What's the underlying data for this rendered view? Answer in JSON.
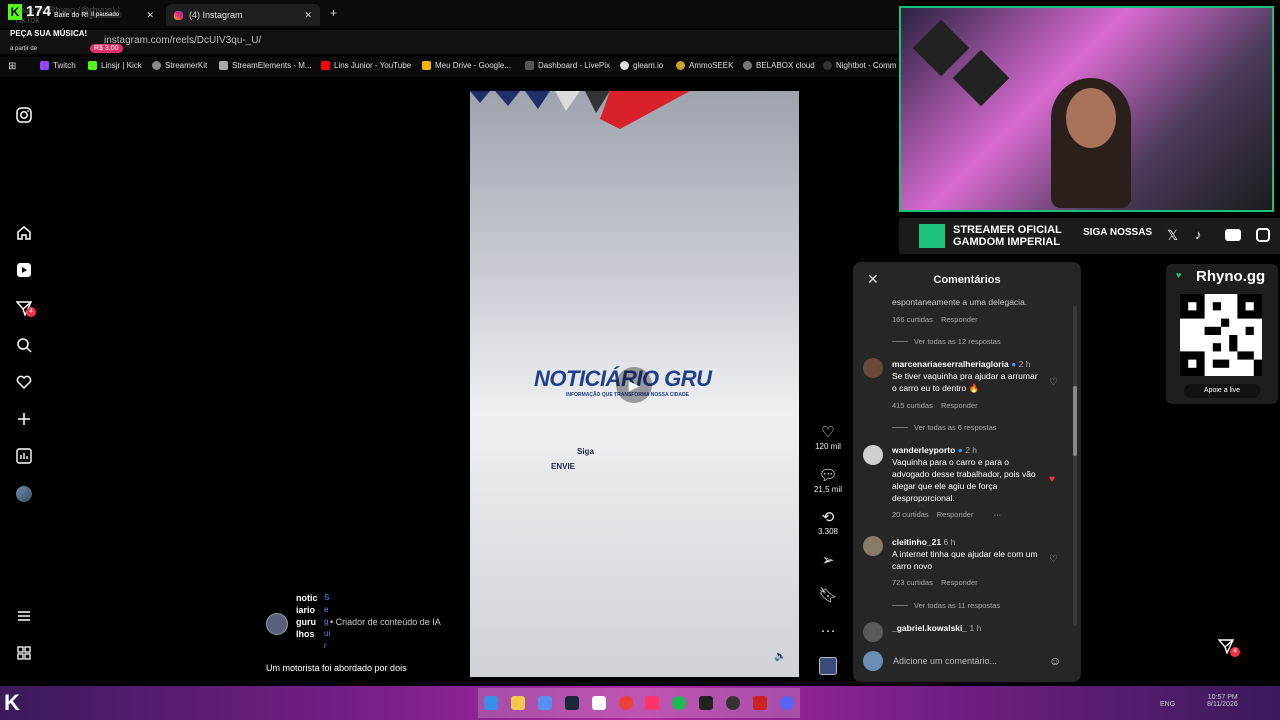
{
  "browser": {
    "tabs": [
      {
        "label": "Baile do Rhyno (@rhyno) | TikTok",
        "active": false
      },
      {
        "label": "(4) Instagram",
        "active": true
      }
    ],
    "url": "instagram.com/reels/DcUIV3qu-_U/",
    "bookmarks": [
      "Twitch",
      "Linsjr | Kick",
      "StreamerKit",
      "StreamElements - M...",
      "Lins Junior - YouTube",
      "Meu Drive - Google...",
      "Dashboard - LivePix",
      "gleam.io",
      "AmmoSEEK",
      "BELABOX cloud",
      "Nightbot - Comm"
    ]
  },
  "kick_overlay": {
    "viewers": "174",
    "title": "Baile do Rhyno",
    "status": "II pausado",
    "request": "PEÇA SUA MÚSICA!",
    "from": "a partir de",
    "price": "R$ 3,00"
  },
  "left_nav": {
    "notification_count": "4"
  },
  "reel": {
    "logo_title": "NOTICIÁRIO GRU",
    "logo_subtitle": "INFORMAÇÃO QUE TRANSFORMA NOSSA CIDADE",
    "overlay_line1": "Siga",
    "overlay_line2": "ENVIE"
  },
  "actions": {
    "likes": "120 mil",
    "comments": "21,5 mil",
    "reposts": "3.308"
  },
  "creator": {
    "name": "noticiariogurulhos",
    "follow": "Seguir",
    "tag": "• Criador de conteúdo de IA",
    "caption": "Um motorista foi abordado por dois"
  },
  "comments_panel": {
    "title": "Comentários",
    "top_text": "espontaneamente a uma delegacia.",
    "top_meta": {
      "likes": "166 curtidas",
      "reply": "Responder"
    },
    "top_replies": "Ver todas as 12 respostas",
    "comments": [
      {
        "user": "marcenariaeserralheriagloria",
        "time": "2 h",
        "text": "Se tiver vaquinha pra ajudar a arrumar o carro eu to dentro 🔥",
        "likes": "415 curtidas",
        "reply": "Responder",
        "replies": "Ver todas as 6 respostas",
        "liked": false
      },
      {
        "user": "wanderleyporto",
        "time": "2 h",
        "text": "Vaquinha para o carro e para o advogado desse trabalhador, pois vão alegar que ele agiu de força desproporcional.",
        "likes": "20 curtidas",
        "reply": "Responder",
        "more": "···",
        "liked": true
      },
      {
        "user": "cleitinho_21",
        "time": "6 h",
        "text": "A internet tinha que ajudar ele com um carro novo",
        "likes": "723 curtidas",
        "reply": "Responder",
        "replies": "Ver todas as 11 respostas",
        "liked": false
      },
      {
        "user": "_gabriel.kowalski_",
        "time": "1 h",
        "text": "",
        "liked": false
      }
    ],
    "input_placeholder": "Adicione um comentário..."
  },
  "stream_overlay": {
    "banner_line1": "STREAMER OFICIAL",
    "banner_line2": "GAMDOM IMPERIAL",
    "banner_siga": "SIGA NOSSAS",
    "rhyno_brand": "Rhyno.gg",
    "apoie": "Apoie a live"
  },
  "taskbar": {
    "lang": "ENG",
    "time": "10:57 PM",
    "date": "8/11/2026"
  },
  "filter_badge": "4"
}
